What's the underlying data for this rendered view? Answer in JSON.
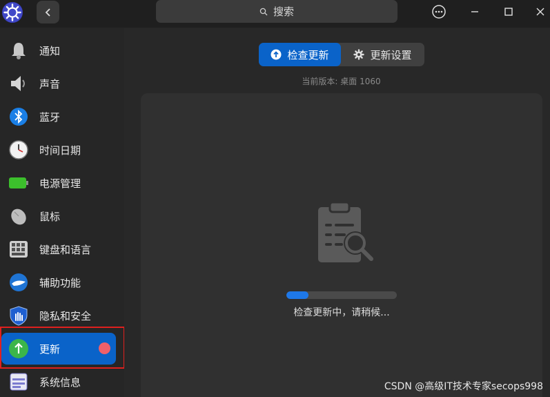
{
  "titlebar": {
    "search_placeholder": "搜索",
    "icons": [
      "app-logo-icon",
      "back-icon",
      "search-icon",
      "more-icon",
      "minimize-icon",
      "maximize-icon",
      "close-icon"
    ]
  },
  "sidebar": {
    "items": [
      {
        "label": "通知",
        "icon": "bell-icon"
      },
      {
        "label": "声音",
        "icon": "speaker-icon"
      },
      {
        "label": "蓝牙",
        "icon": "bluetooth-icon"
      },
      {
        "label": "时间日期",
        "icon": "clock-icon"
      },
      {
        "label": "电源管理",
        "icon": "battery-icon"
      },
      {
        "label": "鼠标",
        "icon": "mouse-icon"
      },
      {
        "label": "键盘和语言",
        "icon": "keyboard-icon"
      },
      {
        "label": "辅助功能",
        "icon": "accessibility-icon"
      },
      {
        "label": "隐私和安全",
        "icon": "shield-icon"
      },
      {
        "label": "更新",
        "icon": "update-arrow-icon",
        "active": true,
        "badge": true
      },
      {
        "label": "系统信息",
        "icon": "system-info-icon"
      }
    ]
  },
  "main": {
    "tabs": [
      {
        "label": "检查更新",
        "icon": "up-arrow-circle-icon",
        "active": true
      },
      {
        "label": "更新设置",
        "icon": "gear-icon",
        "active": false
      }
    ],
    "version_text": "当前版本: 桌面 1060",
    "progress": 0.2,
    "status_text": "检查更新中，请稍候..."
  },
  "watermark": "CSDN @高级IT技术专家secops998",
  "colors": {
    "accent": "#0a63c9",
    "badge": "#f0606a",
    "highlight": "#e0201e"
  }
}
